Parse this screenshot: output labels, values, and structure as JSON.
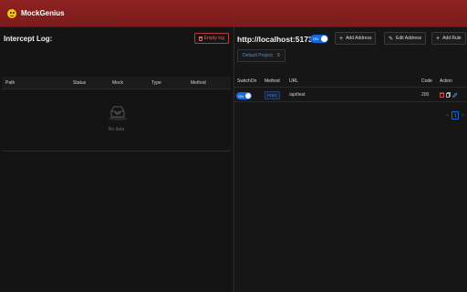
{
  "app": {
    "title": "MockGenius",
    "icon": "smiley-logo-icon"
  },
  "left": {
    "title": "Intercept Log:",
    "empty_button": "Empty log",
    "columns": [
      "Path",
      "Status",
      "Mock",
      "Type",
      "Method"
    ],
    "empty_text": "No data"
  },
  "right": {
    "address": "http://localhost:5173",
    "switch_label": "ON",
    "buttons": {
      "add_address": "Add Address",
      "edit_address": "Edit Address",
      "add_rule": "Add Rule"
    },
    "tab": {
      "label": "Default Project",
      "close": "X"
    },
    "columns": [
      "SwitchOn",
      "Method",
      "URL",
      "Code",
      "Action"
    ],
    "rows": [
      {
        "switch": "ON",
        "method": "POST",
        "url": "/api/test",
        "code": "200"
      }
    ],
    "pagination": {
      "prev": "<",
      "page": "1",
      "next": ">"
    }
  },
  "colors": {
    "header": "#8e2222",
    "accent": "#1668dc",
    "danger": "#b33a3a"
  }
}
